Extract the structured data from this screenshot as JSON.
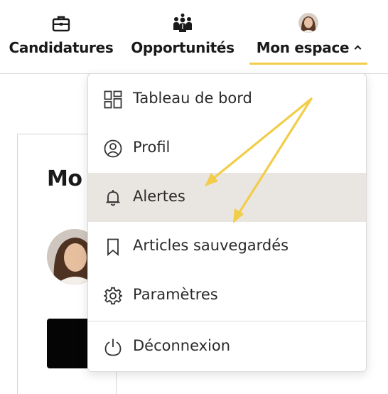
{
  "nav": {
    "items": [
      {
        "label": "Candidatures",
        "icon": "briefcase-icon"
      },
      {
        "label": "Opportunités",
        "icon": "people-group-icon"
      },
      {
        "label": "Mon espace",
        "icon": "avatar",
        "active": true
      }
    ]
  },
  "background": {
    "title": "Mo"
  },
  "menu": {
    "items": [
      {
        "label": "Tableau de bord",
        "icon": "dashboard-grid-icon"
      },
      {
        "label": "Profil",
        "icon": "user-circle-icon"
      },
      {
        "label": "Alertes",
        "icon": "bell-icon",
        "highlighted": true
      },
      {
        "label": "Articles sauvegardés",
        "icon": "bookmark-icon"
      },
      {
        "label": "Paramètres",
        "icon": "gear-icon"
      },
      {
        "label": "Déconnexion",
        "icon": "power-icon"
      }
    ]
  },
  "colors": {
    "accent_underline": "#f2cd4a",
    "arrow": "#f2cd4a",
    "highlight_row": "#e9e5e1"
  }
}
